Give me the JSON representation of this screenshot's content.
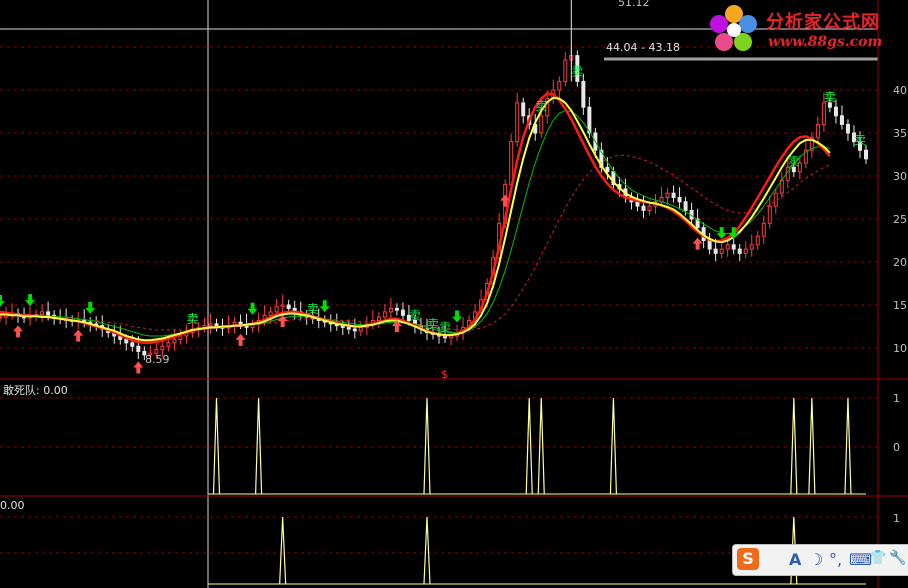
{
  "colors": {
    "background": "#000000",
    "grid": "#8b0000",
    "axis": "#a00000",
    "candle_up": "#ff3b3b",
    "candle_down": "#e8e8e8",
    "ma_fast": "#ff1a1a",
    "ma_slow": "#ffff40",
    "ma_mid": "#00c000",
    "ma_long": "#d02020",
    "buy_arrow": "#ff5050",
    "sell_arrow": "#00dd00",
    "sell_text": "#00ff40",
    "signal_line": "#ffff99"
  },
  "main_panel": {
    "price_axis_labels": [
      "40",
      "35",
      "30",
      "25",
      "20",
      "15",
      "10"
    ],
    "high_label": "51.12",
    "range_label": "44.04 - 43.18",
    "low_label": "8.59",
    "dollar_marker": "$",
    "sell_text": "卖"
  },
  "indicator_panel_1": {
    "title": "敢死队: 0.00",
    "axis_labels": [
      "1",
      "0"
    ]
  },
  "indicator_panel_2": {
    "title": "0.00",
    "axis_labels": [
      "1",
      "1"
    ]
  },
  "logo": {
    "title": "分析家公式网",
    "url": "www.88gs.com"
  },
  "ime_toolbar": {
    "logo": "S",
    "items": [
      "A",
      "☽",
      "°,",
      "⌨",
      "👕",
      "🔧"
    ]
  },
  "chart_data": [
    {
      "type": "candlestick",
      "title": "",
      "ylim": [
        8,
        52
      ],
      "y_ticks": [
        10,
        15,
        20,
        25,
        30,
        35,
        40
      ],
      "annotations": [
        {
          "text": "51.12",
          "y": 51.12
        },
        {
          "text": "44.04 - 43.18",
          "y": 44.04
        },
        {
          "text": "8.59",
          "y": 8.59
        }
      ],
      "close": [
        13.6,
        13.9,
        14.0,
        13.8,
        13.5,
        13.7,
        13.9,
        14.2,
        13.8,
        13.6,
        13.4,
        13.2,
        13.1,
        13.3,
        13.0,
        12.8,
        12.6,
        12.2,
        11.8,
        11.4,
        11.0,
        10.6,
        10.2,
        9.6,
        9.2,
        9.4,
        9.8,
        10.2,
        10.6,
        11.0,
        11.4,
        11.8,
        12.2,
        12.4,
        12.6,
        12.8,
        12.5,
        12.3,
        12.6,
        13.0,
        12.8,
        12.4,
        12.7,
        13.2,
        13.8,
        14.2,
        14.8,
        15.0,
        14.6,
        14.2,
        13.8,
        13.6,
        13.4,
        13.2,
        13.0,
        12.8,
        12.6,
        12.4,
        12.2,
        12.0,
        12.4,
        12.8,
        13.2,
        13.6,
        14.2,
        14.6,
        14.4,
        13.8,
        13.2,
        12.6,
        12.2,
        11.8,
        11.6,
        11.4,
        11.2,
        11.4,
        11.8,
        12.4,
        13.2,
        14.2,
        15.6,
        17.5,
        20.5,
        24.5,
        29.0,
        34.0,
        38.5,
        37.0,
        36.0,
        35.0,
        37.0,
        39.0,
        40.0,
        41.0,
        43.5,
        44.0,
        41.0,
        38.0,
        35.0,
        33.0,
        31.0,
        30.5,
        29.0,
        28.5,
        27.5,
        27.0,
        26.5,
        26.0,
        26.5,
        27.0,
        27.5,
        28.0,
        27.5,
        27.0,
        26.0,
        25.0,
        24.0,
        22.5,
        21.5,
        21.0,
        21.5,
        22.0,
        21.5,
        21.0,
        21.5,
        22.0,
        23.0,
        24.5,
        26.5,
        28.0,
        29.5,
        31.0,
        30.5,
        31.5,
        33.0,
        34.5,
        36.0,
        38.5,
        38.0,
        37.0,
        36.0,
        35.0,
        34.0,
        33.0,
        32.0
      ],
      "ma_fast": [
        14.2,
        14.1,
        14.0,
        13.9,
        13.8,
        13.8,
        13.7,
        13.7,
        13.6,
        13.5,
        13.4,
        13.3,
        13.2,
        13.1,
        12.9,
        12.7,
        12.5,
        12.3,
        12.1,
        11.8,
        11.5,
        11.2,
        10.9,
        10.7,
        10.6,
        10.6,
        10.7,
        10.9,
        11.1,
        11.3,
        11.6,
        11.8,
        12.0,
        12.2,
        12.3,
        12.4,
        12.4,
        12.5,
        12.5,
        12.6,
        12.6,
        12.7,
        12.8,
        13.0,
        13.3,
        13.6,
        13.9,
        14.1,
        14.2,
        14.2,
        14.1,
        13.9,
        13.7,
        13.5,
        13.3,
        13.1,
        12.9,
        12.7,
        12.6,
        12.5,
        12.5,
        12.6,
        12.8,
        13.0,
        13.2,
        13.4,
        13.4,
        13.2,
        12.9,
        12.6,
        12.3,
        12.0,
        11.8,
        11.6,
        11.5,
        11.5,
        11.7,
        12.0,
        12.5,
        13.3,
        14.6,
        16.4,
        18.8,
        21.8,
        25.0,
        28.5,
        31.8,
        34.5,
        36.5,
        38.0,
        39.0,
        39.6,
        39.5,
        38.8,
        37.8,
        36.6,
        35.2,
        33.8,
        32.4,
        31.1,
        30.0,
        29.1,
        28.4,
        27.9,
        27.5,
        27.3,
        27.1,
        27.0,
        26.9,
        26.8,
        26.6,
        26.3,
        25.9,
        25.4,
        24.8,
        24.1,
        23.5,
        23.0,
        22.6,
        22.4,
        22.5,
        22.8,
        23.4,
        24.2,
        25.2,
        26.3,
        27.5,
        28.7,
        29.9,
        31.1,
        32.2,
        33.2,
        34.0,
        34.5,
        34.6,
        34.3,
        33.8,
        33.1,
        32.3
      ],
      "ma_slow": [
        13.9,
        13.9,
        13.8,
        13.8,
        13.7,
        13.7,
        13.7,
        13.6,
        13.6,
        13.5,
        13.4,
        13.3,
        13.2,
        13.1,
        13.0,
        12.8,
        12.6,
        12.4,
        12.2,
        12.0,
        11.7,
        11.4,
        11.2,
        11.0,
        10.9,
        10.9,
        11.0,
        11.1,
        11.3,
        11.5,
        11.7,
        11.9,
        12.1,
        12.2,
        12.3,
        12.4,
        12.4,
        12.5,
        12.5,
        12.6,
        12.6,
        12.7,
        12.8,
        12.9,
        13.1,
        13.4,
        13.7,
        13.9,
        14.0,
        14.0,
        13.9,
        13.8,
        13.6,
        13.4,
        13.2,
        13.0,
        12.8,
        12.7,
        12.6,
        12.5,
        12.5,
        12.6,
        12.7,
        12.9,
        13.1,
        13.2,
        13.2,
        13.0,
        12.8,
        12.5,
        12.2,
        11.9,
        11.7,
        11.6,
        11.5,
        11.5,
        11.6,
        11.8,
        12.2,
        12.8,
        13.8,
        15.2,
        17.2,
        19.8,
        22.8,
        26.0,
        29.2,
        32.0,
        34.4,
        36.2,
        37.6,
        38.6,
        39.1,
        39.0,
        38.5,
        37.6,
        36.4,
        35.1,
        33.7,
        32.4,
        31.2,
        30.2,
        29.3,
        28.6,
        28.0,
        27.6,
        27.3,
        27.1,
        26.9,
        26.8,
        26.6,
        26.4,
        26.1,
        25.6,
        25.0,
        24.4,
        23.7,
        23.1,
        22.7,
        22.4,
        22.3,
        22.5,
        22.9,
        23.5,
        24.3,
        25.2,
        26.3,
        27.4,
        28.6,
        29.8,
        31.0,
        32.1,
        33.0,
        33.8,
        34.2,
        34.2,
        33.9,
        33.4,
        32.7
      ],
      "ma_mid": [
        14.0,
        14.0,
        13.9,
        13.9,
        13.9,
        13.8,
        13.8,
        13.8,
        13.7,
        13.7,
        13.6,
        13.6,
        13.5,
        13.4,
        13.3,
        13.2,
        13.1,
        12.9,
        12.7,
        12.5,
        12.3,
        12.1,
        11.9,
        11.7,
        11.5,
        11.4,
        11.4,
        11.4,
        11.5,
        11.6,
        11.7,
        11.9,
        12.0,
        12.1,
        12.2,
        12.3,
        12.3,
        12.4,
        12.5,
        12.5,
        12.6,
        12.6,
        12.7,
        12.8,
        12.9,
        13.1,
        13.3,
        13.5,
        13.6,
        13.7,
        13.7,
        13.7,
        13.6,
        13.5,
        13.4,
        13.3,
        13.1,
        13.0,
        12.9,
        12.8,
        12.7,
        12.7,
        12.7,
        12.8,
        12.9,
        13.0,
        13.0,
        13.0,
        12.9,
        12.8,
        12.6,
        12.4,
        12.2,
        12.0,
        11.9,
        11.8,
        11.8,
        11.9,
        12.1,
        12.5,
        13.1,
        14.0,
        15.3,
        17.0,
        19.0,
        21.4,
        24.0,
        26.6,
        29.2,
        31.5,
        33.5,
        35.2,
        36.5,
        37.3,
        37.6,
        37.5,
        37.0,
        36.2,
        35.2,
        34.0,
        32.8,
        31.6,
        30.6,
        29.7,
        29.0,
        28.4,
        28.0,
        27.7,
        27.4,
        27.2,
        27.0,
        26.8,
        26.5,
        26.2,
        25.8,
        25.4,
        24.9,
        24.4,
        24.0,
        23.6,
        23.4,
        23.3,
        23.4,
        23.7,
        24.2,
        24.8,
        25.6,
        26.5,
        27.5,
        28.5,
        29.5,
        30.5,
        31.4,
        32.2,
        32.8,
        33.2,
        33.4,
        33.4,
        33.2
      ],
      "ma_long": [
        13.7,
        13.7,
        13.7,
        13.7,
        13.6,
        13.6,
        13.6,
        13.6,
        13.6,
        13.5,
        13.5,
        13.5,
        13.4,
        13.4,
        13.3,
        13.3,
        13.2,
        13.1,
        13.0,
        12.9,
        12.8,
        12.7,
        12.5,
        12.4,
        12.3,
        12.2,
        12.1,
        12.1,
        12.1,
        12.1,
        12.1,
        12.1,
        12.2,
        12.2,
        12.3,
        12.3,
        12.4,
        12.4,
        12.5,
        12.5,
        12.6,
        12.6,
        12.7,
        12.7,
        12.8,
        12.9,
        13.0,
        13.1,
        13.2,
        13.3,
        13.3,
        13.4,
        13.4,
        13.4,
        13.4,
        13.3,
        13.3,
        13.2,
        13.2,
        13.1,
        13.1,
        13.0,
        13.0,
        13.0,
        13.0,
        13.0,
        13.0,
        12.9,
        12.9,
        12.8,
        12.7,
        12.6,
        12.5,
        12.4,
        12.3,
        12.2,
        12.1,
        12.1,
        12.1,
        12.2,
        12.3,
        12.6,
        12.9,
        13.4,
        14.0,
        14.8,
        15.8,
        16.9,
        18.1,
        19.4,
        20.8,
        22.2,
        23.6,
        25.0,
        26.3,
        27.5,
        28.6,
        29.6,
        30.4,
        31.1,
        31.6,
        32.0,
        32.3,
        32.4,
        32.4,
        32.3,
        32.1,
        31.9,
        31.6,
        31.3,
        30.9,
        30.5,
        30.1,
        29.6,
        29.1,
        28.6,
        28.1,
        27.6,
        27.1,
        26.7,
        26.3,
        26.0,
        25.8,
        25.7,
        25.7,
        25.8,
        26.0,
        26.3,
        26.7,
        27.1,
        27.6,
        28.1,
        28.6,
        29.2,
        29.7,
        30.2,
        30.6,
        31.0,
        31.3
      ]
    },
    {
      "type": "bar",
      "title": "敢死队: 0.00",
      "ylim": [
        -1,
        1
      ],
      "signal_bars": [
        36,
        43,
        71,
        88,
        90,
        102,
        132,
        135,
        141
      ],
      "values": [
        1,
        1,
        1,
        1,
        1,
        1,
        1,
        1,
        1
      ]
    },
    {
      "type": "bar",
      "title": "0.00",
      "ylim": [
        0,
        1
      ],
      "signal_bars": [
        47,
        71,
        132
      ],
      "values": [
        1,
        1,
        1
      ]
    }
  ],
  "signals": {
    "buy_bars": [
      3,
      13,
      23,
      40,
      47,
      66,
      84,
      116,
      147
    ],
    "sell_bars": [
      0,
      5,
      15,
      42,
      54,
      76,
      120,
      122,
      150
    ],
    "sell_text_bars": [
      32,
      52,
      69,
      72,
      74,
      90,
      96,
      132,
      138,
      143
    ],
    "dollar_bar": 75
  }
}
